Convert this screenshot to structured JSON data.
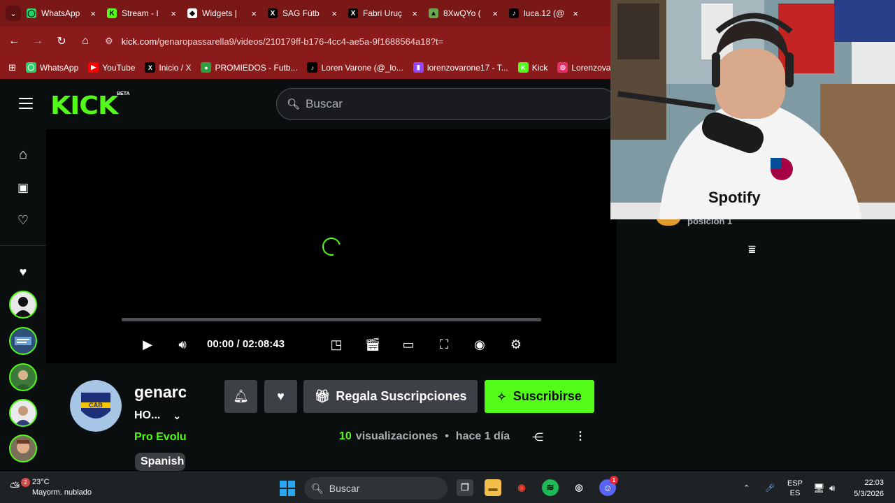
{
  "browser": {
    "tabs": [
      {
        "label": "WhatsApp",
        "icon": "whatsapp-icon",
        "color": "#25d366",
        "glyph": "◯"
      },
      {
        "label": "Stream - I",
        "icon": "kick-icon",
        "color": "#53fc18",
        "glyph": "K"
      },
      {
        "label": "Widgets |",
        "icon": "widgets-icon",
        "color": "#ffffff",
        "glyph": "◆"
      },
      {
        "label": "SAG Fútb",
        "icon": "x-icon",
        "color": "#000000",
        "glyph": "X"
      },
      {
        "label": "Fabri Uruç",
        "icon": "x-icon",
        "color": "#000000",
        "glyph": "X"
      },
      {
        "label": "8XwQYo (",
        "icon": "image-icon",
        "color": "#6aa84f",
        "glyph": "▲"
      },
      {
        "label": "luca.12 (@",
        "icon": "tiktok-icon",
        "color": "#000000",
        "glyph": "♪"
      }
    ],
    "url_domain": "kick.com",
    "url_path": "/genaropassarella9/videos/210179ff-b176-4cc4-ae5a-9f1688564a18?t=",
    "bookmarks": [
      {
        "label": "WhatsApp",
        "color": "#25d366",
        "glyph": "◯"
      },
      {
        "label": "YouTube",
        "color": "#ff0000",
        "glyph": "▶"
      },
      {
        "label": "Inicio / X",
        "color": "#000000",
        "glyph": "X"
      },
      {
        "label": "PROMIEDOS - Futb...",
        "color": "#2e9e3e",
        "glyph": "●"
      },
      {
        "label": "Loren Varone (@_lo...",
        "color": "#000000",
        "glyph": "♪"
      },
      {
        "label": "lorenzovarone17 - T...",
        "color": "#9146ff",
        "glyph": "▮"
      },
      {
        "label": "Kick",
        "color": "#53fc18",
        "glyph": "K"
      },
      {
        "label": "Lorenzovaro",
        "color": "#e1306c",
        "glyph": "◎"
      }
    ]
  },
  "kick": {
    "logo": "KICK",
    "beta": "BETA",
    "search_placeholder": "Buscar",
    "player": {
      "time_current": "00:00",
      "time_total": "02:08:43",
      "progress": 0.0
    },
    "channel": {
      "name": "genarc",
      "title": "HO...",
      "category": "Pro Evolu",
      "tag": "Spanish",
      "gift_label": "Regala Suscripciones",
      "subscribe_label": "Suscribirse",
      "views_count": "10",
      "views_label": "visualizaciones",
      "age": "hace 1 día"
    }
  },
  "chat": {
    "partial_text": "posición 1"
  },
  "taskbar": {
    "temperature": "23°C",
    "weather_desc": "Mayorm. nublado",
    "weather_badge": "2",
    "search_placeholder": "Buscar",
    "lang_top": "ESP",
    "lang_bottom": "ES",
    "time": "22:03",
    "date": "5/3/2026",
    "discord_badge": "1"
  },
  "colors": {
    "kick_green": "#53fc18",
    "browser_red": "#8b1b1b",
    "page_bg": "#0b0e0f"
  }
}
